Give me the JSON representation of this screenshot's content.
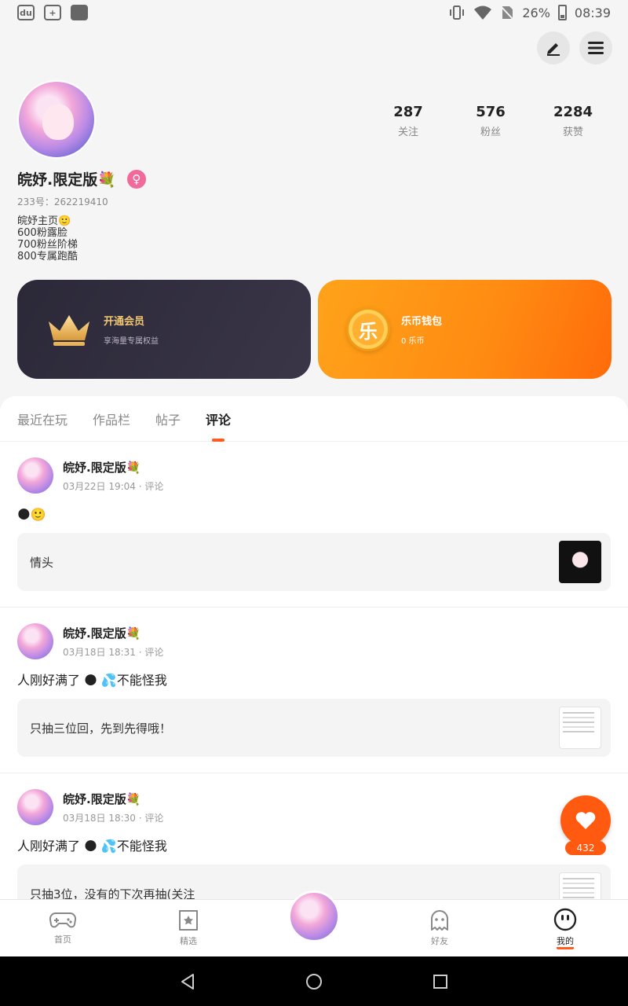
{
  "status_bar": {
    "battery": "26%",
    "time": "08:39"
  },
  "profile": {
    "nickname": "皖妤.限定版💐",
    "gender_symbol": "♀",
    "uid": "233号：262219410",
    "bio_lines": [
      "皖妤主页🙂",
      "600粉露脸",
      "700粉丝阶梯",
      "800专属跑酷"
    ],
    "stats": [
      {
        "value": "287",
        "label": "关注"
      },
      {
        "value": "576",
        "label": "粉丝"
      },
      {
        "value": "2284",
        "label": "获赞"
      }
    ]
  },
  "cards": {
    "vip": {
      "title": "开通会员",
      "subtitle": "享海量专属权益"
    },
    "wallet": {
      "icon_text": "乐",
      "title": "乐币钱包",
      "subtitle": "0 乐币"
    }
  },
  "tabs": [
    {
      "label": "最近在玩"
    },
    {
      "label": "作品栏"
    },
    {
      "label": "帖子"
    },
    {
      "label": "评论",
      "active": true
    }
  ],
  "posts": [
    {
      "name": "皖妤.限定版💐",
      "meta": "03月22日 19:04 · 评论",
      "text": "🌑🙂",
      "quote": "情头",
      "thumb": "anime-girl-thumb"
    },
    {
      "name": "皖妤.限定版💐",
      "meta": "03月18日 18:31 · 评论",
      "text": "人刚好满了 🌑 💦不能怪我",
      "quote": "只抽三位回，先到先得哦！",
      "thumb": "document-thumb"
    },
    {
      "name": "皖妤.限定版💐",
      "meta": "03月18日 18:30 · 评论",
      "text": "人刚好满了 🌑 💦不能怪我",
      "quote": "只抽3位，没有的下次再抽(关注",
      "thumb": "document-thumb"
    }
  ],
  "like_fab": {
    "count": "432"
  },
  "bottom_nav": [
    {
      "label": "首页",
      "icon": "gamepad-icon"
    },
    {
      "label": "精选",
      "icon": "star-badge-icon"
    },
    {
      "label": "",
      "icon": "avatar"
    },
    {
      "label": "好友",
      "icon": "ghost-icon"
    },
    {
      "label": "我的",
      "icon": "smiley-icon",
      "active": true
    }
  ],
  "colors": {
    "accent": "#ff5a1f",
    "vip_bg": "#2b2838",
    "wallet_bg": "#ff9214"
  }
}
